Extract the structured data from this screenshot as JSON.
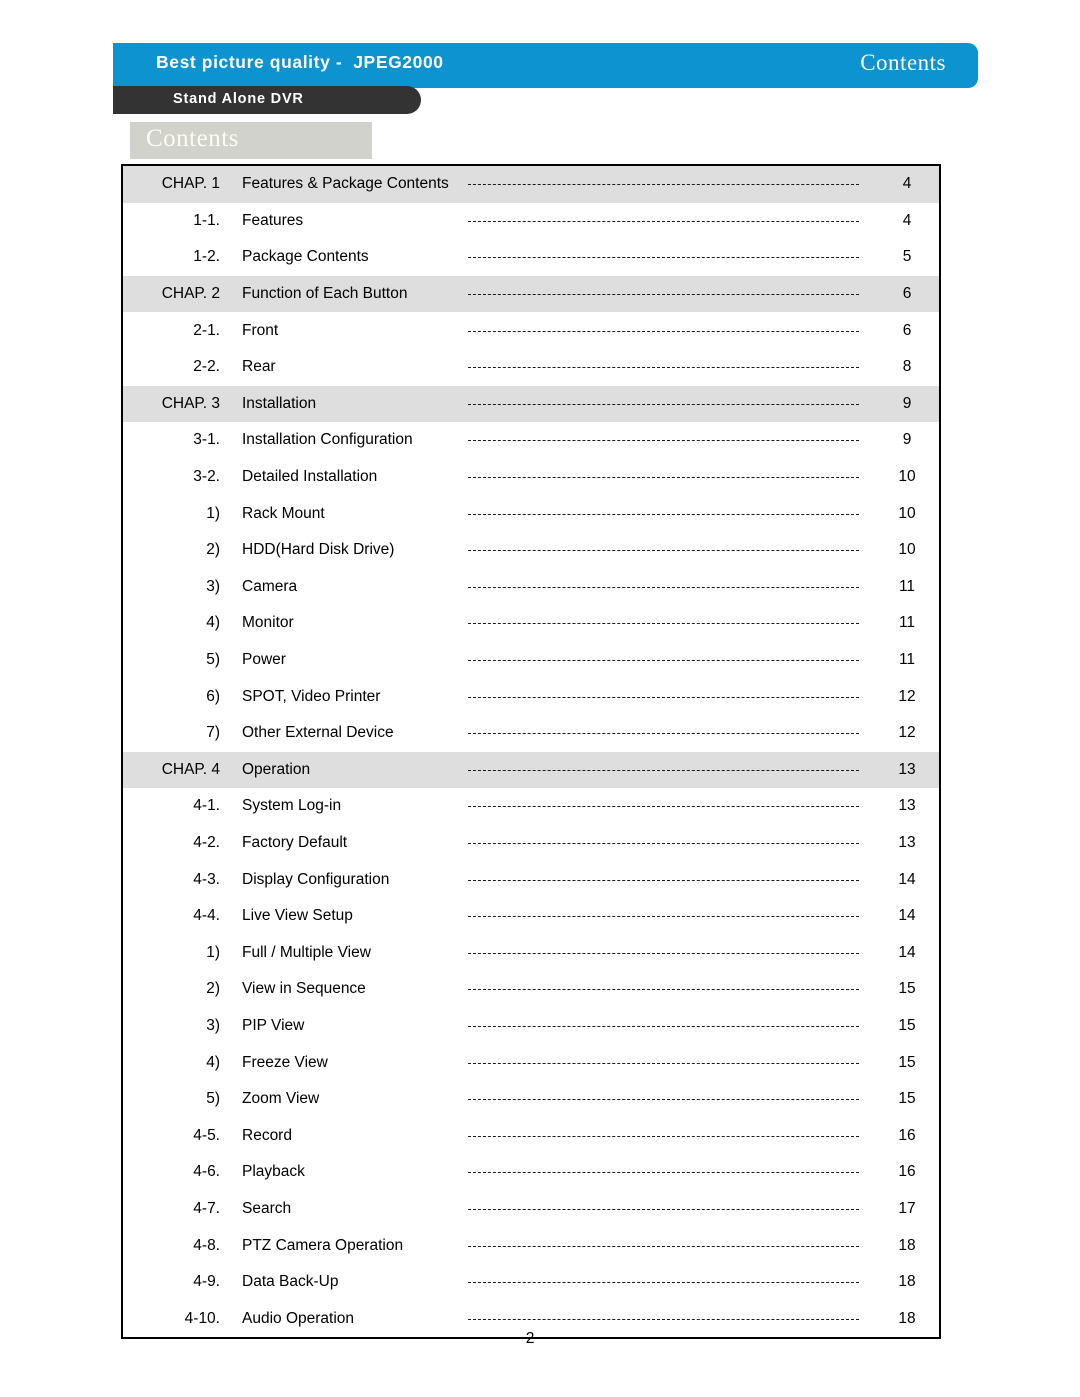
{
  "header": {
    "main_title": "Best picture quality -  JPEG2000",
    "right_title": "Contents",
    "sub_title": "Stand Alone DVR"
  },
  "contents_box": {
    "title": "Contents"
  },
  "colors": {
    "header_blue": "#0d93cf",
    "subheader_dark": "#333333",
    "contents_box_gray": "#d2d2cc",
    "chapter_row_gray": "#dedede"
  },
  "toc": {
    "rows": [
      {
        "level": "chapter",
        "num": "CHAP. 1",
        "label": "Features & Package Contents",
        "page": "4"
      },
      {
        "level": "sub",
        "num": "1-1.",
        "label": "Features",
        "page": "4"
      },
      {
        "level": "sub",
        "num": "1-2.",
        "label": "Package Contents",
        "page": "5"
      },
      {
        "level": "chapter",
        "num": "CHAP. 2",
        "label": "Function of Each Button",
        "page": "6"
      },
      {
        "level": "sub",
        "num": "2-1.",
        "label": "Front",
        "page": "6"
      },
      {
        "level": "sub",
        "num": "2-2.",
        "label": "Rear",
        "page": "8"
      },
      {
        "level": "chapter",
        "num": "CHAP. 3",
        "label": "Installation",
        "page": "9"
      },
      {
        "level": "sub",
        "num": "3-1.",
        "label": "Installation Configuration",
        "page": "9"
      },
      {
        "level": "sub",
        "num": "3-2.",
        "label": "Detailed Installation",
        "page": "10"
      },
      {
        "level": "subsub",
        "num": "1)",
        "label": "Rack Mount",
        "page": "10"
      },
      {
        "level": "subsub",
        "num": "2)",
        "label": "HDD(Hard Disk Drive)",
        "page": "10"
      },
      {
        "level": "subsub",
        "num": "3)",
        "label": "Camera",
        "page": "11"
      },
      {
        "level": "subsub",
        "num": "4)",
        "label": "Monitor",
        "page": "11"
      },
      {
        "level": "subsub",
        "num": "5)",
        "label": "Power",
        "page": "11"
      },
      {
        "level": "subsub",
        "num": "6)",
        "label": "SPOT, Video Printer",
        "page": "12"
      },
      {
        "level": "subsub",
        "num": "7)",
        "label": "Other External Device",
        "page": "12"
      },
      {
        "level": "chapter",
        "num": "CHAP. 4",
        "label": "Operation",
        "page": "13"
      },
      {
        "level": "sub",
        "num": "4-1.",
        "label": "System Log-in",
        "page": "13"
      },
      {
        "level": "sub",
        "num": "4-2.",
        "label": "Factory Default",
        "page": "13"
      },
      {
        "level": "sub",
        "num": "4-3.",
        "label": "Display Configuration",
        "page": "14"
      },
      {
        "level": "sub",
        "num": "4-4.",
        "label": "Live View Setup",
        "page": "14"
      },
      {
        "level": "subsub",
        "num": "1)",
        "label": "Full / Multiple View",
        "page": "14"
      },
      {
        "level": "subsub",
        "num": "2)",
        "label": "View in Sequence",
        "page": "15"
      },
      {
        "level": "subsub",
        "num": "3)",
        "label": "PIP View",
        "page": "15"
      },
      {
        "level": "subsub",
        "num": "4)",
        "label": "Freeze View",
        "page": "15"
      },
      {
        "level": "subsub",
        "num": "5)",
        "label": "Zoom View",
        "page": "15"
      },
      {
        "level": "sub",
        "num": "4-5.",
        "label": "Record",
        "page": "16"
      },
      {
        "level": "sub",
        "num": "4-6.",
        "label": "Playback",
        "page": "16"
      },
      {
        "level": "sub",
        "num": "4-7.",
        "label": "Search",
        "page": "17"
      },
      {
        "level": "sub",
        "num": "4-8.",
        "label": "PTZ Camera Operation",
        "page": "18"
      },
      {
        "level": "sub",
        "num": "4-9.",
        "label": "Data Back-Up",
        "page": "18"
      },
      {
        "level": "sub",
        "num": "4-10.",
        "label": "Audio Operation",
        "page": "18"
      }
    ]
  },
  "footer": {
    "page_number": "2"
  }
}
